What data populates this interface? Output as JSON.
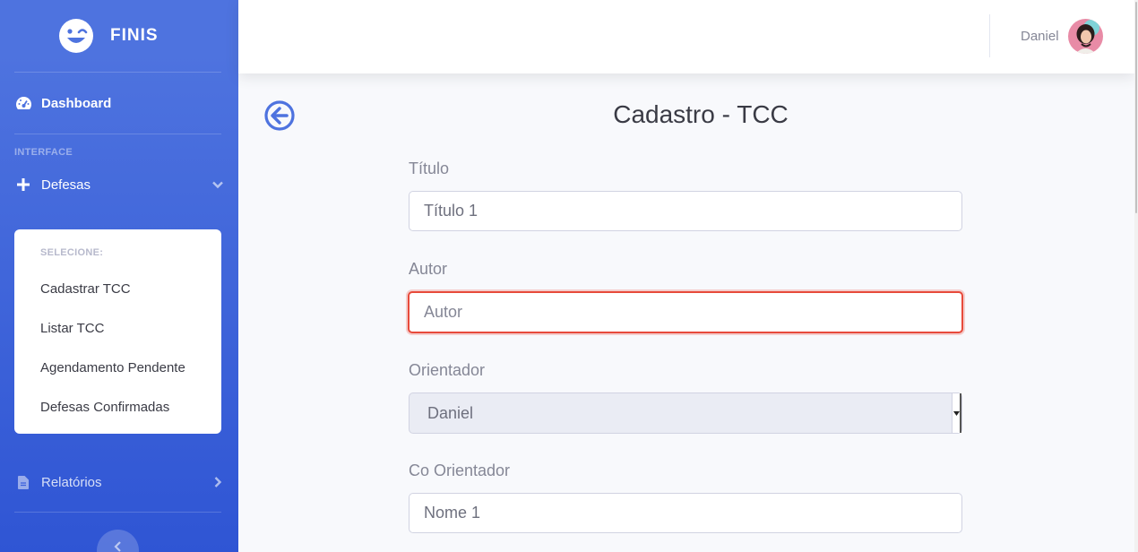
{
  "brand": {
    "name": "FINIS"
  },
  "sidebar": {
    "dashboard_label": "Dashboard",
    "heading": "INTERFACE",
    "defesas_label": "Defesas",
    "collapse": {
      "header": "SELECIONE:",
      "items": [
        "Cadastrar TCC",
        "Listar TCC",
        "Agendamento Pendente",
        "Defesas Confirmadas"
      ]
    },
    "relatorios_label": "Relatórios"
  },
  "topbar": {
    "user_name": "Daniel"
  },
  "page": {
    "title": "Cadastro - TCC"
  },
  "form": {
    "titulo": {
      "label": "Título",
      "value": "Título 1"
    },
    "autor": {
      "label": "Autor",
      "placeholder": "Autor",
      "value": ""
    },
    "orientador": {
      "label": "Orientador",
      "selected": "Daniel"
    },
    "co_orientador": {
      "label": "Co Orientador",
      "value": "Nome 1"
    }
  },
  "colors": {
    "primary": "#4e73df",
    "danger": "#e74a3b"
  },
  "icons": [
    "laugh-wink-icon",
    "tachometer-icon",
    "plus-icon",
    "chevron-down-icon",
    "file-icon",
    "chevron-right-icon",
    "chevron-left-icon",
    "arrow-circle-left-icon"
  ]
}
